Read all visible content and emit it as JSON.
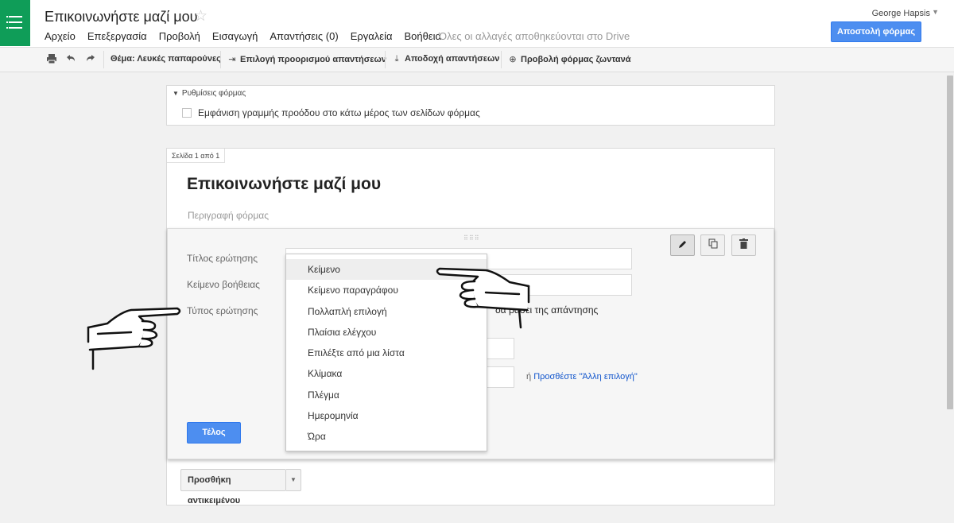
{
  "header": {
    "title": "Επικοινωνήστε μαζί μου",
    "menu": [
      "Αρχείο",
      "Επεξεργασία",
      "Προβολή",
      "Εισαγωγή",
      "Απαντήσεις (0)",
      "Εργαλεία",
      "Βοήθεια"
    ],
    "save_status": "Όλες οι αλλαγές αποθηκεύονται στο Drive",
    "user": "George Hapsis",
    "send_button": "Αποστολή φόρμας",
    "logo_color": "#0f9d58"
  },
  "toolbar": {
    "theme": "Θέμα: Λευκές παπαρούνες",
    "response_dest": "Επιλογή προορισμού απαντήσεων",
    "accept": "Αποδοχή απαντήσεων",
    "live_view": "Προβολή φόρμας ζωντανά"
  },
  "settings": {
    "header": "Ρυθμίσεις φόρμας",
    "progress_bar_label": "Εμφάνιση γραμμής προόδου στο κάτω μέρος των σελίδων φόρμας",
    "progress_bar_checked": false
  },
  "page": {
    "tab": "Σελίδα 1 από 1",
    "form_title": "Επικοινωνήστε μαζί μου",
    "form_description_placeholder": "Περιγραφή φόρμας"
  },
  "question": {
    "title_label": "Τίτλος ερώτησης",
    "help_label": "Κείμενο βοήθειας",
    "type_label": "Τύπος ερώτησης",
    "partial_text": "δα βάσει της απάντησης",
    "other_prefix": "ή",
    "other_link": "Προσθέστε \"Άλλη επιλογή\"",
    "done_button": "Τέλος"
  },
  "type_dropdown": {
    "selected": "Κείμενο",
    "options": [
      "Κείμενο",
      "Κείμενο παραγράφου",
      "Πολλαπλή επιλογή",
      "Πλαίσια ελέγχου",
      "Επιλέξτε από μια λίστα",
      "Κλίμακα",
      "Πλέγμα",
      "Ημερομηνία",
      "Ώρα"
    ]
  },
  "add_item": {
    "label": "Προσθήκη αντικειμένου"
  },
  "colors": {
    "accent_blue": "#4d8ef0",
    "link": "#1155cc"
  }
}
